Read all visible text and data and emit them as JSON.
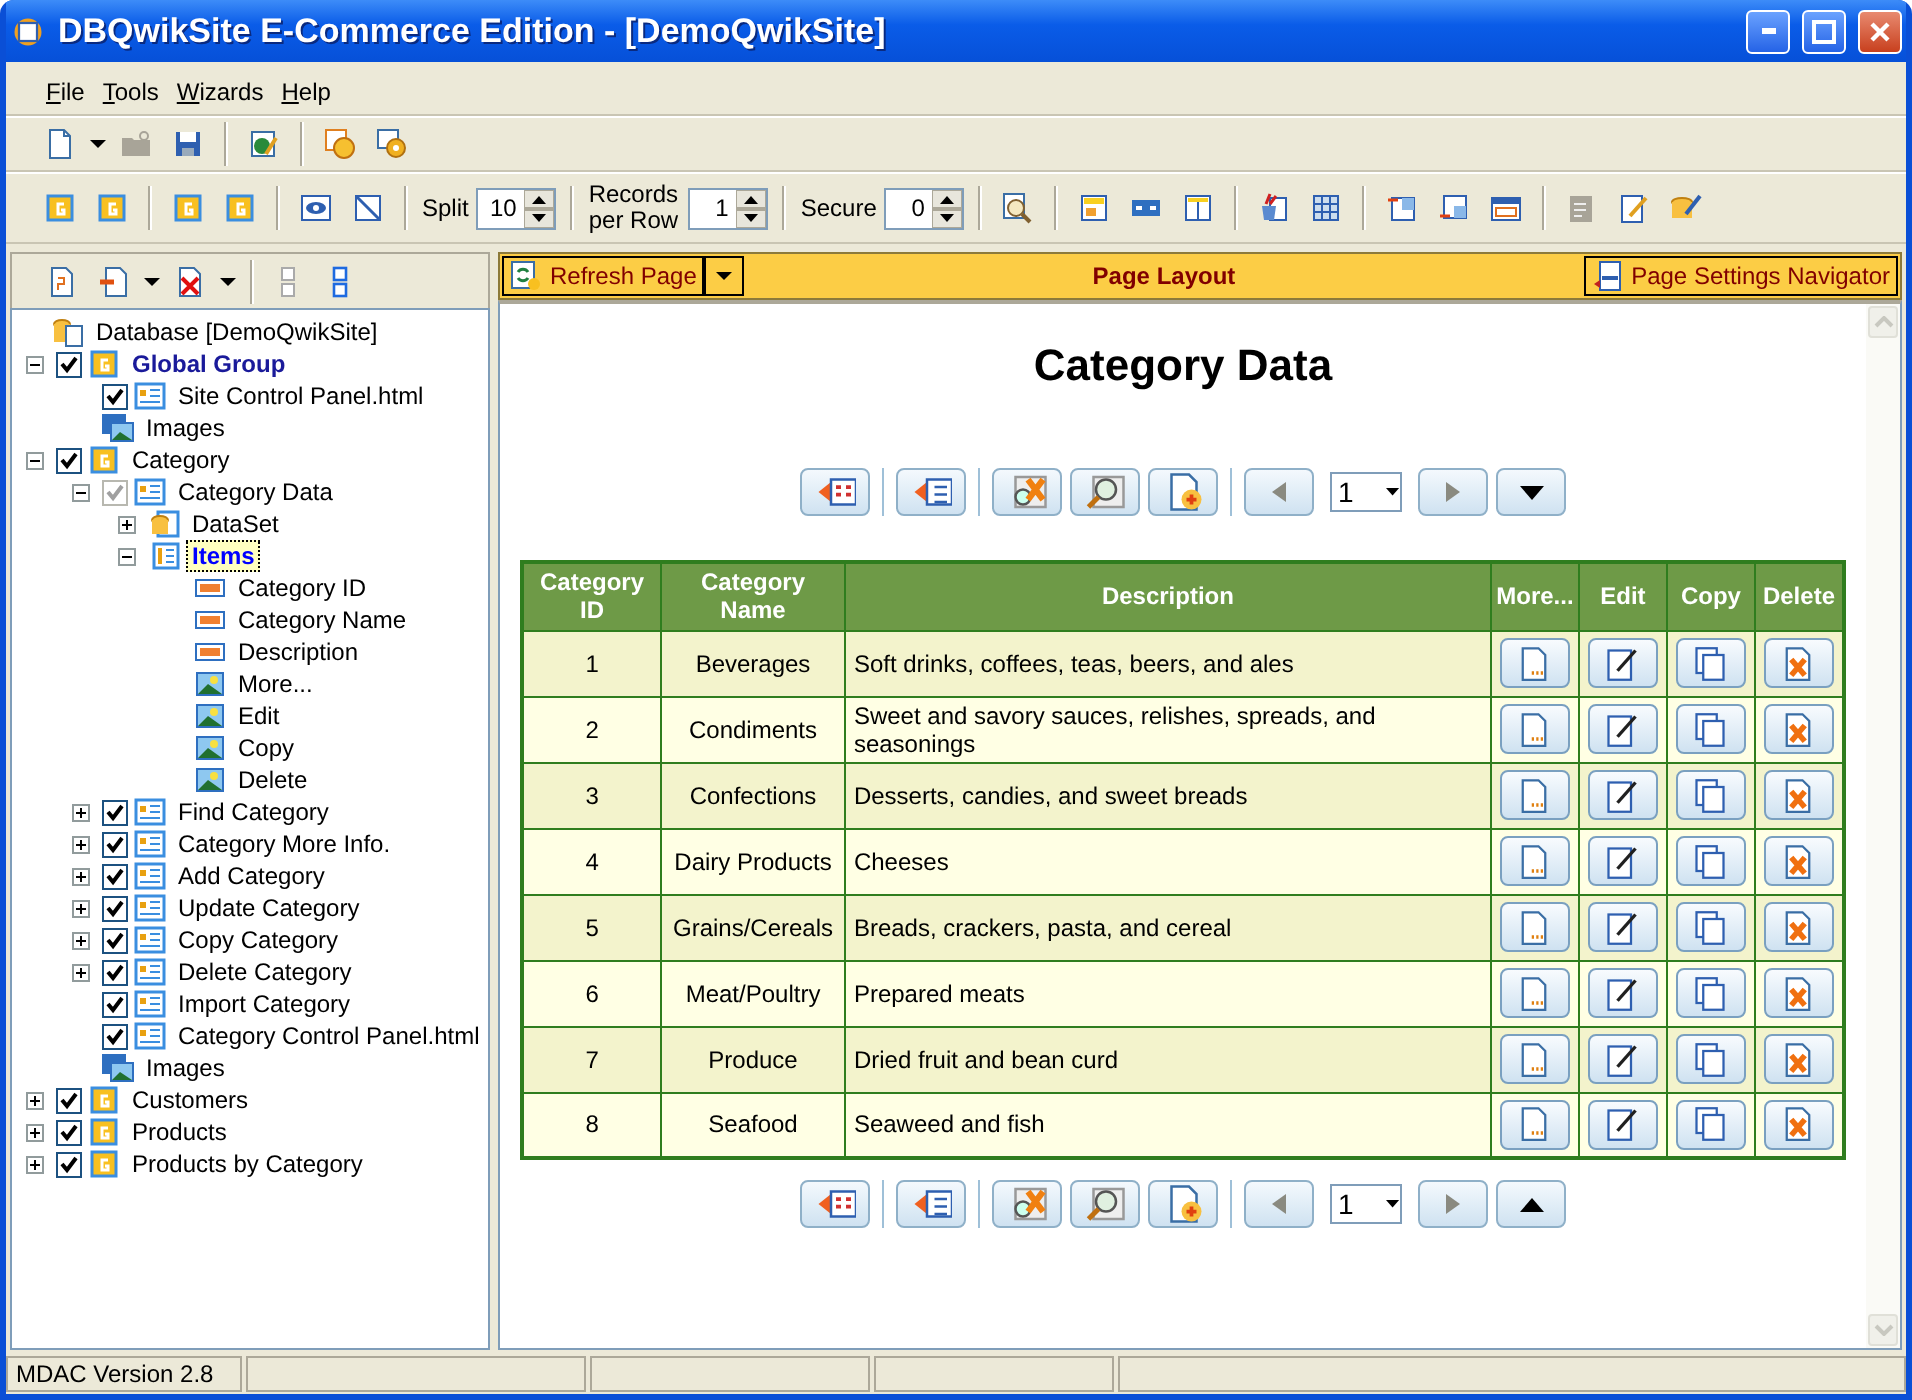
{
  "window": {
    "title": "DBQwikSite E-Commerce Edition - [DemoQwikSite]"
  },
  "menu": [
    "File",
    "Tools",
    "Wizards",
    "Help"
  ],
  "toolbar_fields": [
    {
      "label": "Split",
      "value": "10"
    },
    {
      "label": "Records per Row",
      "value": "1"
    },
    {
      "label": "Secure",
      "value": "0"
    }
  ],
  "tree": [
    {
      "label": "Database [DemoQwikSite]",
      "kind": "database",
      "selected": false
    },
    {
      "label": "Global Group",
      "kind": "group",
      "bold": true,
      "checked": true,
      "expanded": true,
      "selected": false,
      "children": [
        {
          "label": "Site Control Panel.html",
          "kind": "page",
          "checked": true,
          "selected": false
        },
        {
          "label": "Images",
          "kind": "images",
          "selected": false
        }
      ]
    },
    {
      "label": "Category",
      "kind": "group",
      "checked": true,
      "expanded": true,
      "selected": false,
      "children": [
        {
          "label": "Category Data",
          "kind": "page",
          "checked": true,
          "disabled": true,
          "expanded": true,
          "selected": false,
          "children": [
            {
              "label": "DataSet",
              "kind": "dataset",
              "expanded": false,
              "selected": false
            },
            {
              "label": "Items",
              "kind": "items",
              "expanded": true,
              "selected": true,
              "children": [
                {
                  "label": "Category ID",
                  "kind": "text",
                  "selected": false
                },
                {
                  "label": "Category Name",
                  "kind": "text",
                  "selected": false
                },
                {
                  "label": "Description",
                  "kind": "text",
                  "selected": false
                },
                {
                  "label": "More...",
                  "kind": "image",
                  "selected": false
                },
                {
                  "label": "Edit",
                  "kind": "image",
                  "selected": false
                },
                {
                  "label": "Copy",
                  "kind": "image",
                  "selected": false
                },
                {
                  "label": "Delete",
                  "kind": "image",
                  "selected": false
                }
              ]
            }
          ]
        },
        {
          "label": "Find Category",
          "kind": "page",
          "checked": true,
          "expanded": false,
          "selected": false
        },
        {
          "label": "Category More Info.",
          "kind": "page",
          "checked": true,
          "expanded": false,
          "selected": false
        },
        {
          "label": "Add Category",
          "kind": "page",
          "checked": true,
          "expanded": false,
          "selected": false
        },
        {
          "label": "Update Category",
          "kind": "page",
          "checked": true,
          "expanded": false,
          "selected": false
        },
        {
          "label": "Copy Category",
          "kind": "page",
          "checked": true,
          "expanded": false,
          "selected": false
        },
        {
          "label": "Delete Category",
          "kind": "page",
          "checked": true,
          "expanded": false,
          "selected": false
        },
        {
          "label": "Import Category",
          "kind": "page",
          "checked": true,
          "selected": false
        },
        {
          "label": "Category Control Panel.html",
          "kind": "page",
          "checked": true,
          "selected": false
        },
        {
          "label": "Images",
          "kind": "images",
          "selected": false
        }
      ]
    },
    {
      "label": "Customers",
      "kind": "group",
      "checked": true,
      "expanded": false,
      "selected": false
    },
    {
      "label": "Products",
      "kind": "group",
      "checked": true,
      "expanded": false,
      "selected": false
    },
    {
      "label": "Products by Category",
      "kind": "group",
      "checked": true,
      "expanded": false,
      "selected": false
    }
  ],
  "page_bar": {
    "refresh_button": "Refresh Page",
    "title": "Page Layout",
    "settings_button": "Page Settings Navigator"
  },
  "page": {
    "heading": "Category Data",
    "navs": [
      {
        "page_select": "1",
        "kind": "jump_down"
      },
      {
        "page_select": "1",
        "kind": "jump_up"
      }
    ],
    "table": {
      "columns": [
        {
          "label": "Category ID",
          "kind": "text"
        },
        {
          "label": "Category Name",
          "kind": "text"
        },
        {
          "label": "Description",
          "kind": "text"
        },
        {
          "label": "More...",
          "kind": "more"
        },
        {
          "label": "Edit",
          "kind": "edit"
        },
        {
          "label": "Copy",
          "kind": "copy"
        },
        {
          "label": "Delete",
          "kind": "delete"
        }
      ],
      "rows": [
        [
          "1",
          "Beverages",
          "Soft drinks, coffees, teas, beers, and ales"
        ],
        [
          "2",
          "Condiments",
          "Sweet and savory sauces, relishes, spreads, and seasonings"
        ],
        [
          "3",
          "Confections",
          "Desserts, candies, and sweet breads"
        ],
        [
          "4",
          "Dairy Products",
          "Cheeses"
        ],
        [
          "5",
          "Grains/Cereals",
          "Breads, crackers, pasta, and cereal"
        ],
        [
          "6",
          "Meat/Poultry",
          "Prepared meats"
        ],
        [
          "7",
          "Produce",
          "Dried fruit and bean curd"
        ],
        [
          "8",
          "Seafood",
          "Seaweed and fish"
        ]
      ]
    }
  },
  "status_bar": [
    "MDAC Version 2.8"
  ]
}
